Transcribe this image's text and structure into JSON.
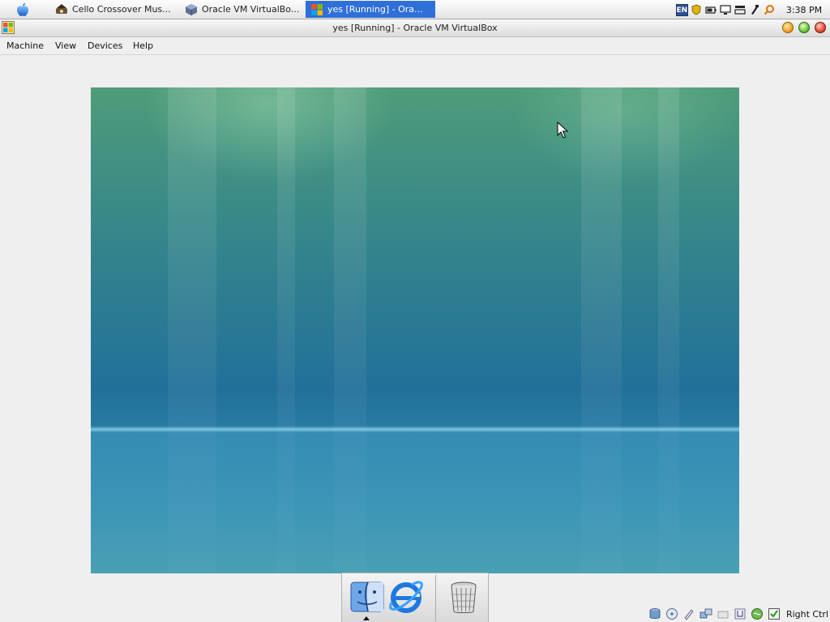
{
  "taskbar": {
    "tasks": [
      {
        "label": "Cello Crossover Mus...",
        "icon": "cello-app-icon",
        "active": false
      },
      {
        "label": "Oracle VM VirtualBo...",
        "icon": "virtualbox-icon",
        "active": false
      },
      {
        "label": "yes [Running] - Ora...",
        "icon": "windows-vm-icon",
        "active": true
      }
    ],
    "tray": {
      "language": "EN",
      "icons": [
        "shield-icon",
        "battery-icon",
        "monitor-icon",
        "network-icon",
        "usb-icon",
        "search-icon"
      ]
    },
    "clock": "3:38 PM"
  },
  "window": {
    "title": "yes [Running] - Oracle VM VirtualBox"
  },
  "menu": {
    "items": [
      "Machine",
      "View",
      "Devices",
      "Help"
    ]
  },
  "dock": {
    "items": [
      "finder-icon",
      "internet-explorer-icon",
      "trash-icon"
    ]
  },
  "statusbar": {
    "icons": [
      "hard-disk-icon",
      "optical-drive-icon",
      "audio-icon",
      "network-adapter-icon",
      "usb-device-icon",
      "shared-folders-icon",
      "mouse-integration-icon",
      "guest-additions-icon"
    ],
    "host_key": "Right Ctrl"
  },
  "colors": {
    "taskbar_active": "#2f6fd8",
    "desktop_top": "#4f9c79",
    "desktop_bottom": "#4aa0b4"
  }
}
